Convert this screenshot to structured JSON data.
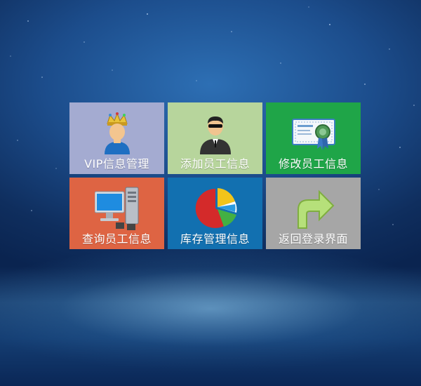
{
  "colors": {
    "vip_tile": "#a4abd1",
    "add_tile": "#b7d59c",
    "edit_tile": "#1fa548",
    "query_tile": "#de6443",
    "inventory_tile": "#1270b0",
    "return_tile": "#a6a6a6",
    "background": "#1c4d8c"
  },
  "tiles": [
    {
      "label": "VIP信息管理",
      "icon": "vip-king-icon"
    },
    {
      "label": "添加员工信息",
      "icon": "employee-agent-icon"
    },
    {
      "label": "修改员工信息",
      "icon": "certificate-icon"
    },
    {
      "label": "查询员工信息",
      "icon": "computer-server-icon"
    },
    {
      "label": "库存管理信息",
      "icon": "pie-chart-icon"
    },
    {
      "label": "返回登录界面",
      "icon": "return-arrow-icon"
    }
  ]
}
